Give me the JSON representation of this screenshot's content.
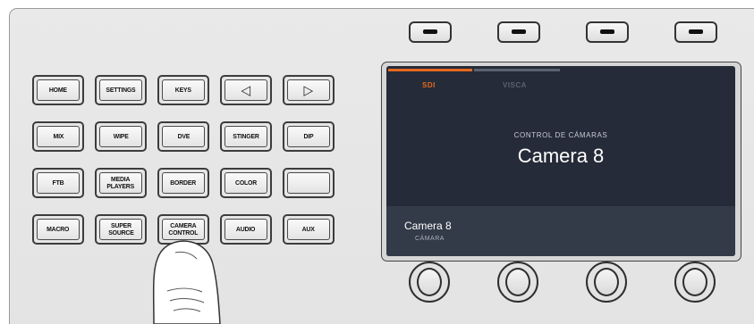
{
  "panel": {
    "buttons": [
      {
        "label": "HOME"
      },
      {
        "label": "SETTINGS"
      },
      {
        "label": "KEYS"
      },
      {
        "label": "◁"
      },
      {
        "label": "▷"
      },
      {
        "label": "MIX"
      },
      {
        "label": "WIPE"
      },
      {
        "label": "DVE"
      },
      {
        "label": "STINGER"
      },
      {
        "label": "DIP"
      },
      {
        "label": "FTB"
      },
      {
        "label": "MEDIA\nPLAYERS"
      },
      {
        "label": "BORDER"
      },
      {
        "label": "COLOR"
      },
      {
        "label": ""
      },
      {
        "label": "MACRO"
      },
      {
        "label": "SUPER\nSOURCE"
      },
      {
        "label": "CAMERA\nCONTROL"
      },
      {
        "label": "AUDIO"
      },
      {
        "label": "AUX"
      }
    ],
    "pressed_button": "CAMERA\nCONTROL"
  },
  "lcd": {
    "tabs": [
      {
        "label": "SDI",
        "active": true
      },
      {
        "label": "VISCA",
        "active": false
      }
    ],
    "heading": "CONTROL DE CÁMARAS",
    "camera_name": "Camera 8",
    "footer": {
      "value": "Camera 8",
      "parameter": "CÁMARA"
    }
  },
  "colors": {
    "accent": "#e4681f",
    "lcd_background": "#252b38",
    "panel": "#e6e6e6"
  },
  "icons": {
    "soft_button": "dash-icon",
    "left_arrow": "left-arrow-icon",
    "right_arrow": "right-arrow-icon",
    "knob": "rotary-knob-icon",
    "hand": "finger-pressing-icon"
  }
}
